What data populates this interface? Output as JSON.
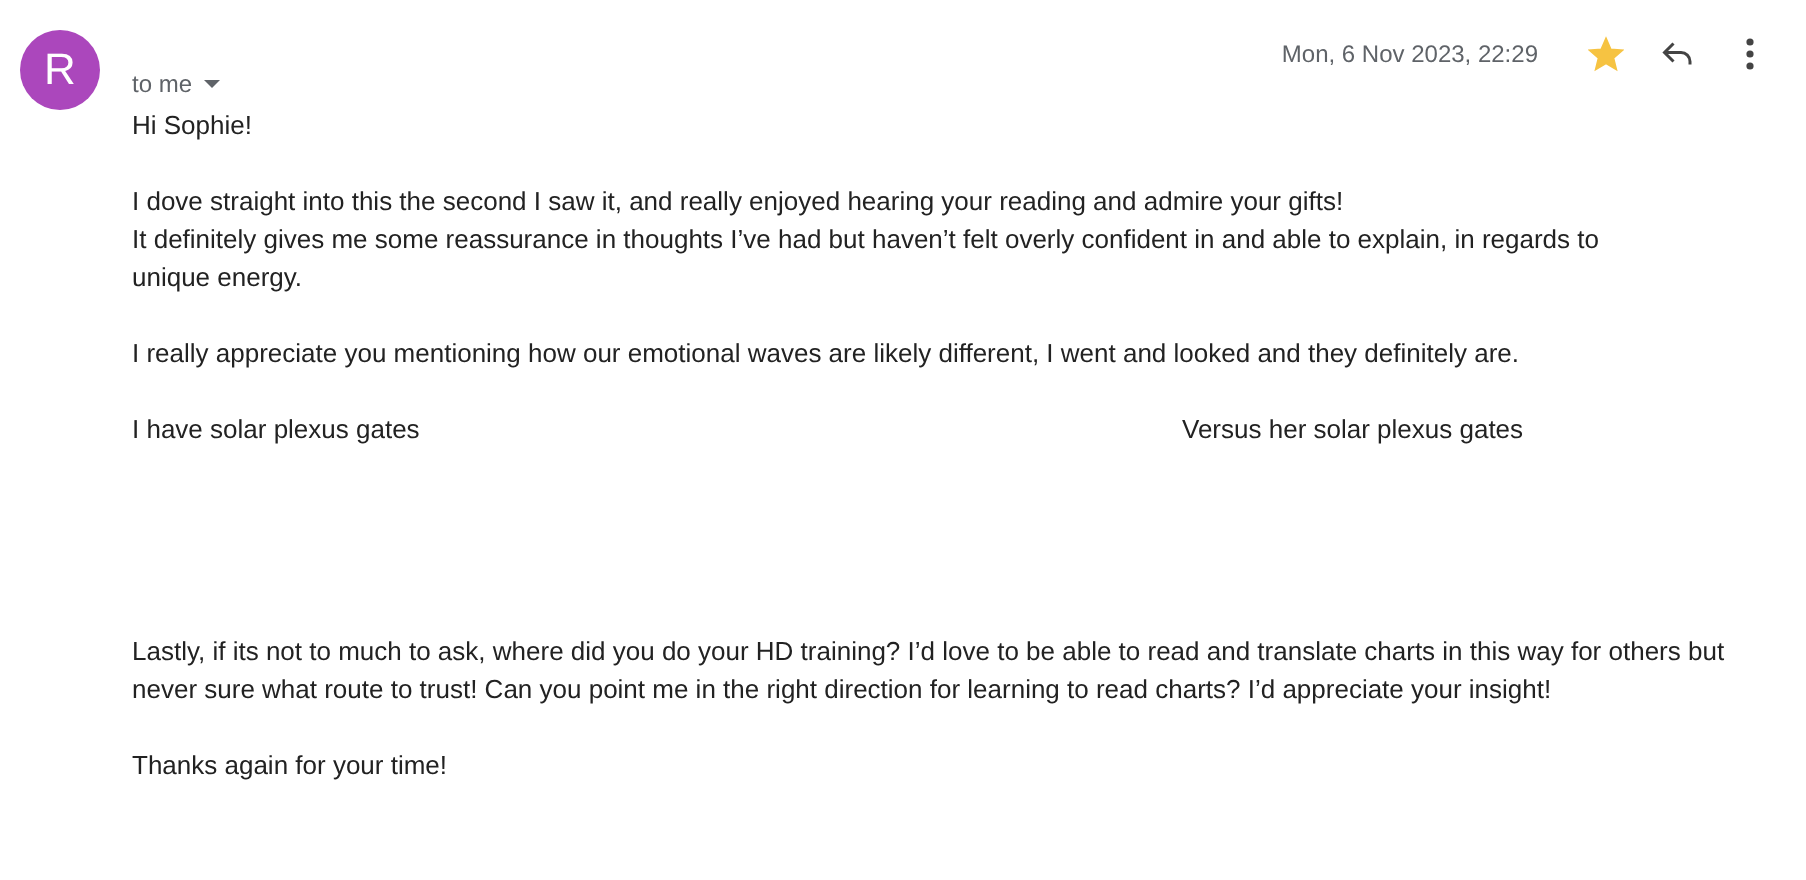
{
  "header": {
    "avatar_initial": "R",
    "recipient": "to me",
    "date": "Mon, 6 Nov 2023, 22:29",
    "starred": true
  },
  "body": [
    {
      "kind": "paragraph",
      "lines": [
        "Hi Sophie!"
      ]
    },
    {
      "kind": "paragraph",
      "lines": [
        "I dove straight into this the second I saw it, and really enjoyed hearing your reading and admire your gifts!",
        "It definitely gives me some reassurance in thoughts I’ve had but haven’t felt overly confident in and able to explain, in regards to",
        "unique energy."
      ]
    },
    {
      "kind": "paragraph",
      "lines": [
        "I really appreciate you mentioning how our emotional waves are likely different, I went and looked and they definitely are."
      ]
    },
    {
      "kind": "columns",
      "texts": [
        "I have solar plexus gates",
        "Versus her solar plexus gates"
      ]
    },
    {
      "kind": "paragraph",
      "lines": [
        "Lastly, if its not to much to ask, where did you do your HD training? I’d love to be able to read and translate charts in this way for others but",
        "never sure what route to trust! Can you point me in the right direction for learning to read charts? I’d appreciate your insight!"
      ]
    },
    {
      "kind": "paragraph",
      "lines": [
        "Thanks again for your time!"
      ]
    }
  ]
}
